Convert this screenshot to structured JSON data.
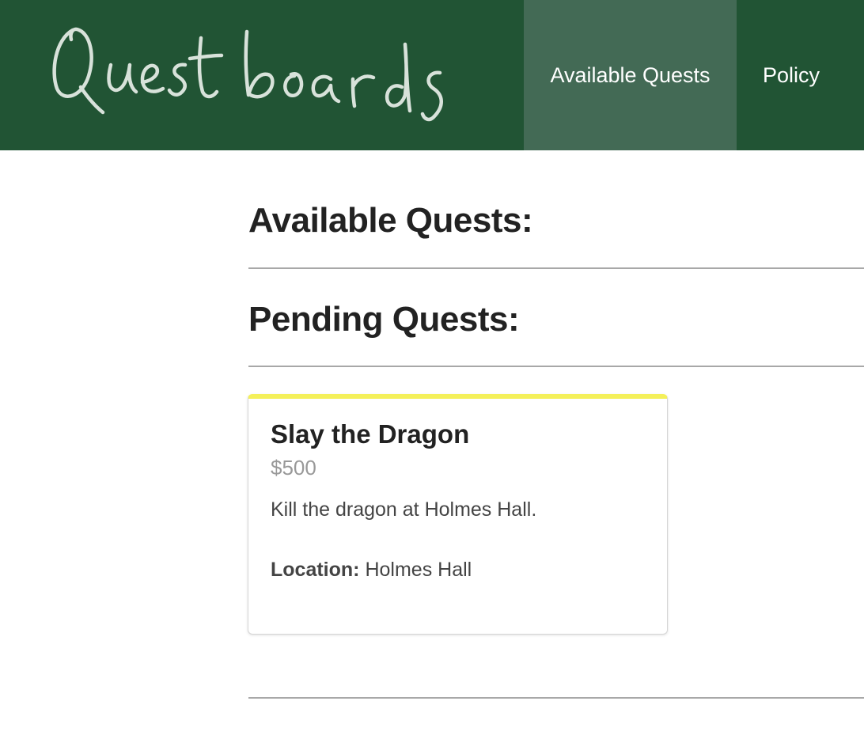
{
  "brand": {
    "logo_text": "Questboards",
    "logo_color": "#e8efe9"
  },
  "nav": {
    "items": [
      {
        "label": "Available Quests",
        "active": true
      },
      {
        "label": "Policy",
        "active": false
      }
    ]
  },
  "colors": {
    "navbar_bg": "#215434",
    "nav_active_bg": "#436a55",
    "card_accent": "#f4f05a",
    "reward_text": "#999999"
  },
  "sections": {
    "available_title": "Available Quests:",
    "pending_title": "Pending Quests:"
  },
  "pending_quests": [
    {
      "title": "Slay the Dragon",
      "reward": "$500",
      "description": "Kill the dragon at Holmes Hall.",
      "location_label": "Location:",
      "location": "Holmes Hall"
    }
  ]
}
